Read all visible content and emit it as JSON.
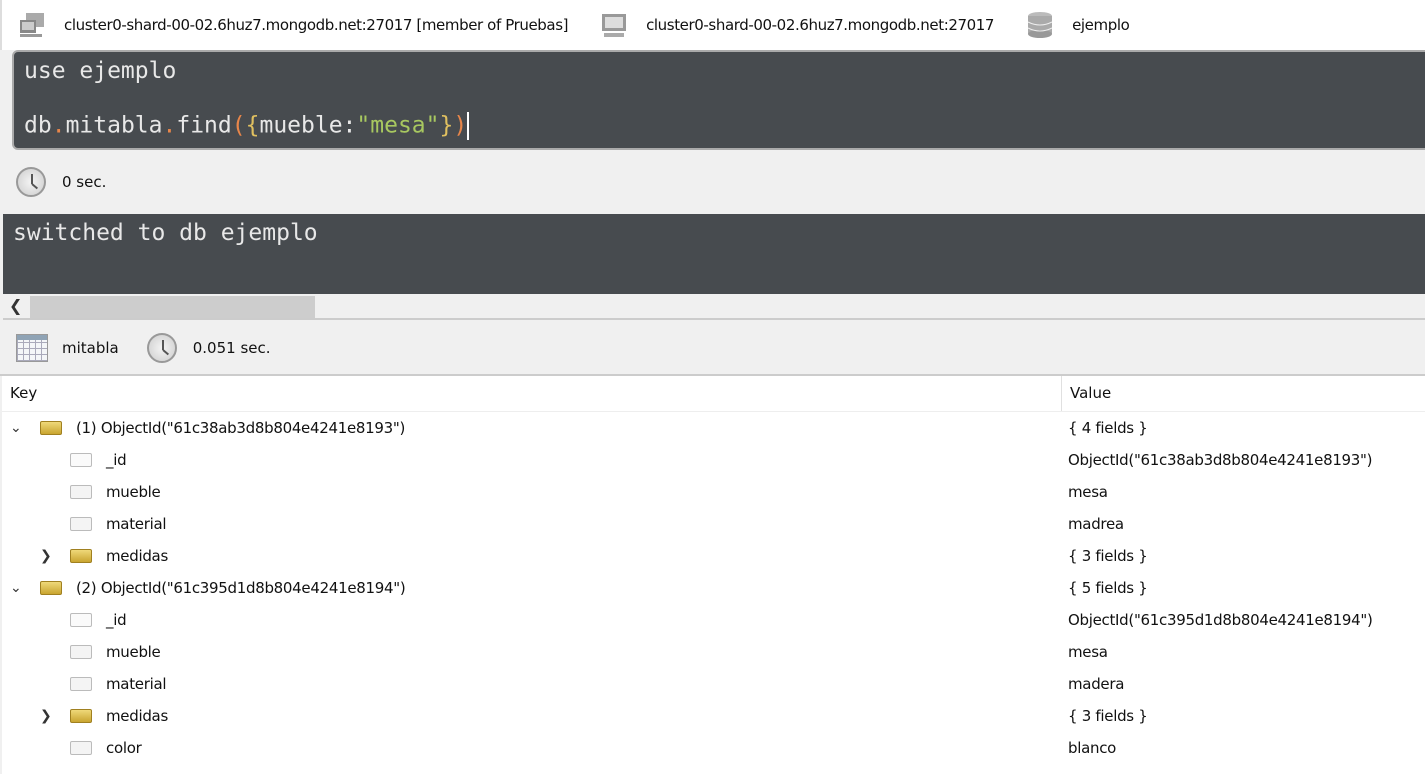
{
  "topbar": {
    "server": "cluster0-shard-00-02.6huz7.mongodb.net:27017 [member of Pruebas]",
    "host": "cluster0-shard-00-02.6huz7.mongodb.net:27017",
    "database": "ejemplo"
  },
  "editor": {
    "line1": "use ejemplo",
    "line2_parts": [
      "db",
      ".",
      "mitabla",
      ".",
      "find",
      "(",
      "{",
      "mueble:",
      "\"mesa\"",
      "}",
      ")"
    ]
  },
  "query_time": "0 sec.",
  "output_text": "switched to db ejemplo",
  "results": {
    "collection": "mitabla",
    "time": "0.051 sec.",
    "columns": {
      "key": "Key",
      "value": "Value"
    },
    "rows": [
      {
        "level": 0,
        "expander": "expanded",
        "type": "object",
        "key": "(1) ObjectId(\"61c38ab3d8b804e4241e8193\")",
        "value": "{ 4 fields }"
      },
      {
        "level": 1,
        "expander": "none",
        "type": "objectid",
        "key": "_id",
        "value": "ObjectId(\"61c38ab3d8b804e4241e8193\")"
      },
      {
        "level": 1,
        "expander": "none",
        "type": "string",
        "key": "mueble",
        "value": "mesa"
      },
      {
        "level": 1,
        "expander": "none",
        "type": "string",
        "key": "material",
        "value": "madrea"
      },
      {
        "level": 1,
        "expander": "collapsed",
        "type": "object",
        "key": "medidas",
        "value": "{ 3 fields }"
      },
      {
        "level": 0,
        "expander": "expanded",
        "type": "object",
        "key": "(2) ObjectId(\"61c395d1d8b804e4241e8194\")",
        "value": "{ 5 fields }"
      },
      {
        "level": 1,
        "expander": "none",
        "type": "objectid",
        "key": "_id",
        "value": "ObjectId(\"61c395d1d8b804e4241e8194\")"
      },
      {
        "level": 1,
        "expander": "none",
        "type": "string",
        "key": "mueble",
        "value": "mesa"
      },
      {
        "level": 1,
        "expander": "none",
        "type": "string",
        "key": "material",
        "value": "madera"
      },
      {
        "level": 1,
        "expander": "collapsed",
        "type": "object",
        "key": "medidas",
        "value": "{ 3 fields }"
      },
      {
        "level": 1,
        "expander": "none",
        "type": "string",
        "key": "color",
        "value": "blanco"
      }
    ]
  },
  "colors": {
    "editor_bg": "#474b4f",
    "punctuation": "#e8864a",
    "brace": "#e0c060",
    "string": "#a8c860"
  }
}
